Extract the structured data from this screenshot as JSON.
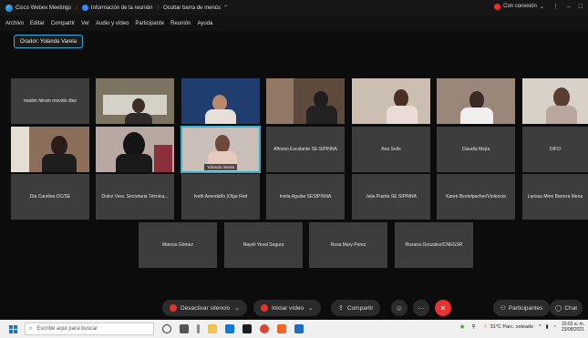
{
  "titlebar": {
    "app_title": "Cisco Webex Meetings",
    "info_label": "Información de la reunión",
    "hide_label": "Ocultar barra de menús",
    "connection_label": "Con conexión",
    "colors": {
      "connection": "#e8322d",
      "accent": "#2d8cff"
    }
  },
  "menu": [
    "Archivo",
    "Editar",
    "Compartir",
    "Ver",
    "Audio y vídeo",
    "Participante",
    "Reunión",
    "Ayuda"
  ],
  "speaker_label": "Orador: Yolanda Varela",
  "tiles": {
    "row1": [
      "madim hilram movido diaz",
      "",
      "",
      "",
      "",
      "",
      ""
    ],
    "row2_video_label": "Yolanda Varela",
    "row2_names": [
      "Alfonso Escalante SE-SIPINNA",
      "Ana Solís",
      "Claudia Mejía",
      "DIFO"
    ],
    "row3": [
      "Dia Carolina OC/SE",
      "Dulce Vera. Secretaria Técnica...",
      "Iveth Avendaño (Olga Red",
      "Invita Aguilar SESIPINNA",
      "Julia Puerta SE SIPINNA",
      "Karen Bestelpacher/Violencia",
      "Larissa Mirei Barrera Mena"
    ],
    "row4": [
      "Marcos Gómez",
      "Nayeli Yeval Segura",
      "Rosa Mary Perez",
      "Roxana Gonzalez/CNEGSR"
    ]
  },
  "controls": {
    "mute_label": "Desactivar silencio",
    "video_label": "Iniciar vídeo",
    "share_label": "Compartir",
    "participants_label": "Participantes",
    "chat_label": "Chat"
  },
  "taskbar": {
    "search_placeholder": "Escribe aquí para buscar",
    "weather": "31°C Parc. soleado",
    "time": "10:02 a. m.",
    "date": "23/08/2021"
  }
}
